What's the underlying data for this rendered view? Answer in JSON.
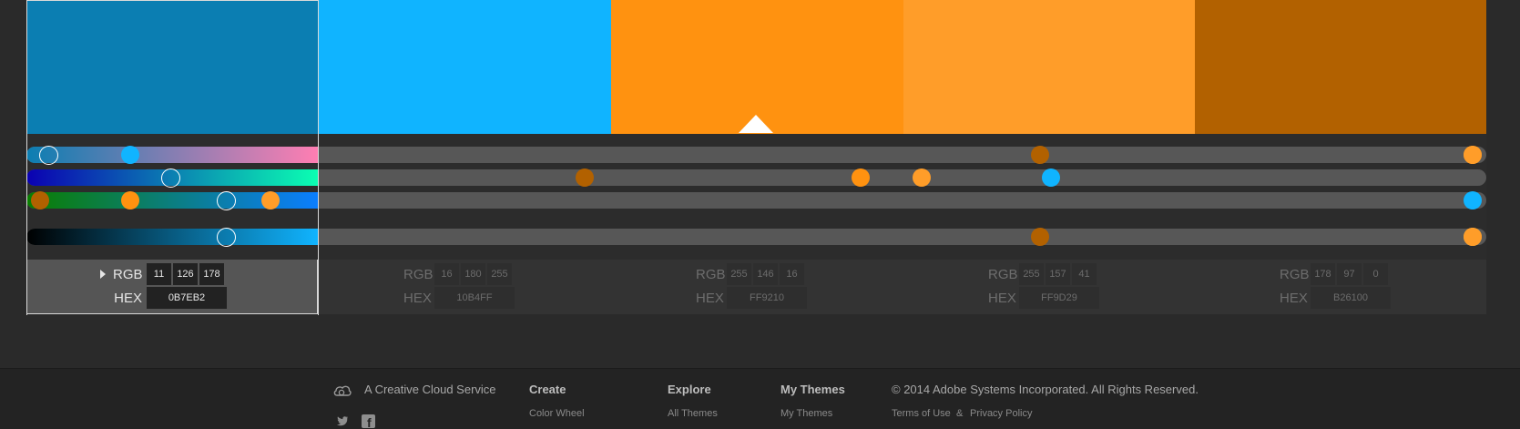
{
  "colors": [
    {
      "hex_color": "#0B7EB2",
      "rgb": [
        "11",
        "126",
        "178"
      ],
      "hex": "0B7EB2",
      "selected": true
    },
    {
      "hex_color": "#10B4FF",
      "rgb": [
        "16",
        "180",
        "255"
      ],
      "hex": "10B4FF",
      "selected": false
    },
    {
      "hex_color": "#FF9210",
      "rgb": [
        "255",
        "146",
        "16"
      ],
      "hex": "FF9210",
      "selected": false
    },
    {
      "hex_color": "#FF9D29",
      "rgb": [
        "255",
        "157",
        "41"
      ],
      "hex": "FF9D29",
      "selected": false
    },
    {
      "hex_color": "#B26100",
      "rgb": [
        "178",
        "97",
        "0"
      ],
      "hex": "B26100",
      "selected": false
    }
  ],
  "labels": {
    "rgb": "RGB",
    "hex": "HEX"
  },
  "base_color_index": 2,
  "footer": {
    "creative_cloud": "A Creative Cloud Service",
    "create": "Create",
    "color_wheel": "Color Wheel",
    "explore": "Explore",
    "all_themes": "All Themes",
    "my_themes_heading": "My Themes",
    "my_themes_link": "My Themes",
    "copyright": "© 2014 Adobe Systems Incorporated. All Rights Reserved.",
    "terms": "Terms of Use",
    "amp": "&",
    "privacy": "Privacy Policy"
  },
  "icons": [
    "creative-cloud-icon",
    "twitter-icon",
    "facebook-icon",
    "disclosure-caret-icon"
  ]
}
